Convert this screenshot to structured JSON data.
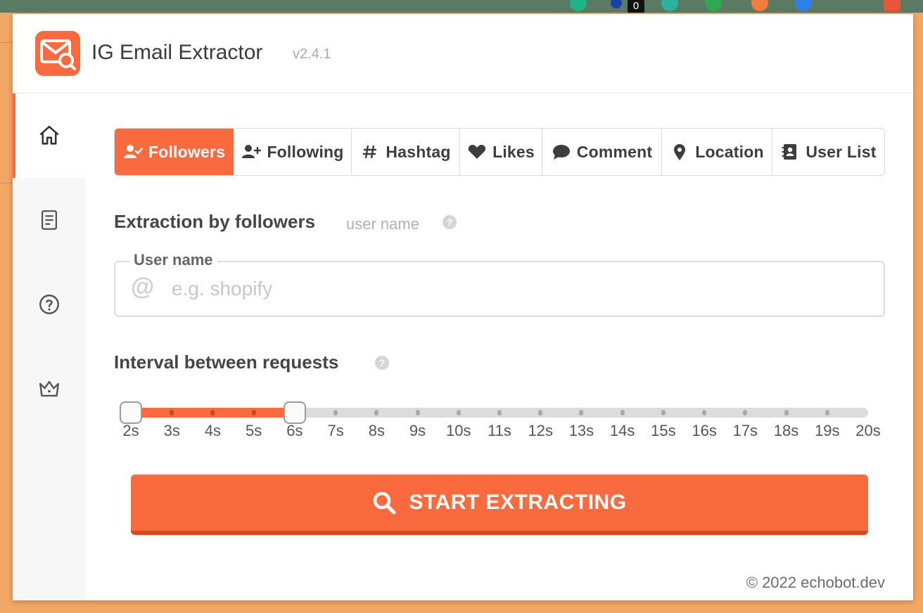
{
  "browser": {
    "extension_badge": "0"
  },
  "app": {
    "title": "IG Email Extractor",
    "version": "v2.4.1",
    "accent_color": "#fa6a3f"
  },
  "sidebar": {
    "items": [
      {
        "name": "home",
        "icon": "home-icon",
        "active": true
      },
      {
        "name": "results",
        "icon": "document-icon",
        "active": false
      },
      {
        "name": "help",
        "icon": "question-circle-icon",
        "active": false
      },
      {
        "name": "premium",
        "icon": "crown-icon",
        "active": false
      }
    ]
  },
  "tabs": [
    {
      "label": "Followers",
      "icon": "user-check-icon",
      "active": true
    },
    {
      "label": "Following",
      "icon": "user-plus-icon",
      "active": false
    },
    {
      "label": "Hashtag",
      "icon": "hash-icon",
      "active": false
    },
    {
      "label": "Likes",
      "icon": "heart-icon",
      "active": false
    },
    {
      "label": "Comment",
      "icon": "comment-icon",
      "active": false
    },
    {
      "label": "Location",
      "icon": "location-pin-icon",
      "active": false
    },
    {
      "label": "User List",
      "icon": "contact-book-icon",
      "active": false
    }
  ],
  "extraction": {
    "title": "Extraction by followers",
    "subtitle": "user name",
    "help": "?"
  },
  "username_field": {
    "label": "User name",
    "prefix": "@",
    "value": "",
    "placeholder": "e.g. shopify"
  },
  "interval": {
    "title": "Interval between requests",
    "help": "?",
    "labels": [
      "2s",
      "3s",
      "4s",
      "5s",
      "6s",
      "7s",
      "8s",
      "9s",
      "10s",
      "11s",
      "12s",
      "13s",
      "14s",
      "15s",
      "16s",
      "17s",
      "18s",
      "19s",
      "20s"
    ],
    "selected_min": "2s",
    "selected_max": "6s"
  },
  "start_button": {
    "label": "START EXTRACTING",
    "icon": "search-icon"
  },
  "footer": {
    "copyright": "© 2022 echobot.dev"
  }
}
